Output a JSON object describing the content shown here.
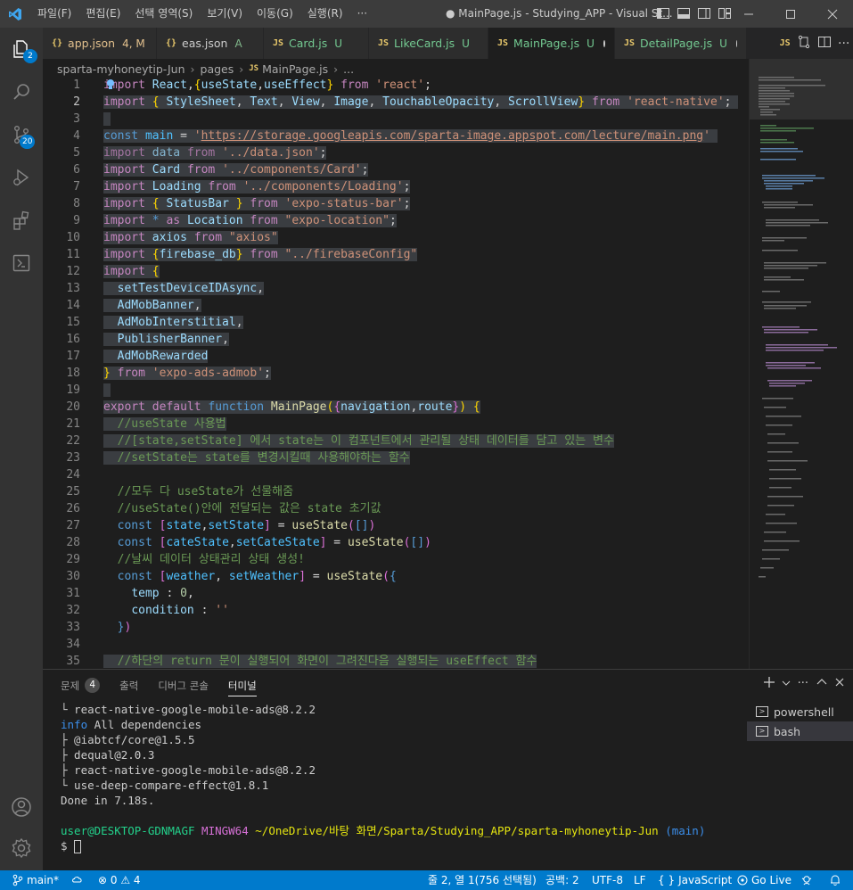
{
  "titlebar": {
    "menu": [
      "파일(F)",
      "편집(E)",
      "선택 영역(S)",
      "보기(V)",
      "이동(G)",
      "실행(R)",
      "···"
    ],
    "window_title": "● MainPage.js - Studying_APP - Visual St..."
  },
  "activitybar": {
    "explorer_badge": "2",
    "scm_badge": "20"
  },
  "tabs": [
    {
      "icon": "{}",
      "name": "app.json",
      "status": "4, M",
      "color": "#e2c08d"
    },
    {
      "icon": "{}",
      "name": "eas.json",
      "status": "A",
      "color": "#81b88b"
    },
    {
      "icon": "JS",
      "name": "Card.js",
      "status": "U",
      "color": "#73c991"
    },
    {
      "icon": "JS",
      "name": "LikeCard.js",
      "status": "U",
      "color": "#73c991"
    },
    {
      "icon": "JS",
      "name": "MainPage.js",
      "status": "U",
      "color": "#73c991"
    },
    {
      "icon": "JS",
      "name": "DetailPage.js",
      "status": "U",
      "color": "#73c991"
    }
  ],
  "breadcrumb": {
    "items": [
      "sparta-myhoneytip-Jun",
      "pages",
      "MainPage.js",
      "..."
    ]
  },
  "editor": {
    "line_numbers": [
      "1",
      "2",
      "3",
      "4",
      "5",
      "6",
      "7",
      "8",
      "9",
      "10",
      "11",
      "12",
      "13",
      "14",
      "15",
      "16",
      "17",
      "18",
      "19",
      "20",
      "21",
      "22",
      "23",
      "24",
      "25",
      "26",
      "27",
      "28",
      "29",
      "30",
      "31",
      "32",
      "33",
      "34",
      "35"
    ],
    "current_line": "2"
  },
  "panel": {
    "tabs": [
      "문제",
      "출력",
      "디버그 콘솔",
      "터미널"
    ],
    "problems_badge": "4",
    "terminal_lines": [
      "└ react-native-google-mobile-ads@8.2.2",
      "All dependencies",
      "├ @iabtcf/core@1.5.5",
      "├ dequal@2.0.3",
      "├ react-native-google-mobile-ads@8.2.2",
      "└ use-deep-compare-effect@1.8.1",
      "Done in 7.18s."
    ],
    "info_label": "info",
    "prompt": {
      "user": "user@DESKTOP-GDNMAGF",
      "shell": "MINGW64",
      "path": "~/OneDrive/바탕 화면/Sparta/Studying_APP/sparta-myhoneytip-Jun",
      "branch": "(main)",
      "symbol": "$"
    },
    "terminals": [
      "powershell",
      "bash"
    ]
  },
  "statusbar": {
    "branch": "main*",
    "problems": "⊗ 0 ⚠ 4",
    "cursor_pos": "줄 2, 열 1(756 선택됨)",
    "indent": "공백: 2",
    "encoding": "UTF-8",
    "eol": "LF",
    "language": "JavaScript",
    "golive": "Go Live"
  },
  "colors": {
    "accent": "#007acc",
    "editor_bg": "#1e1e1e",
    "selection": "#3a3d41"
  }
}
